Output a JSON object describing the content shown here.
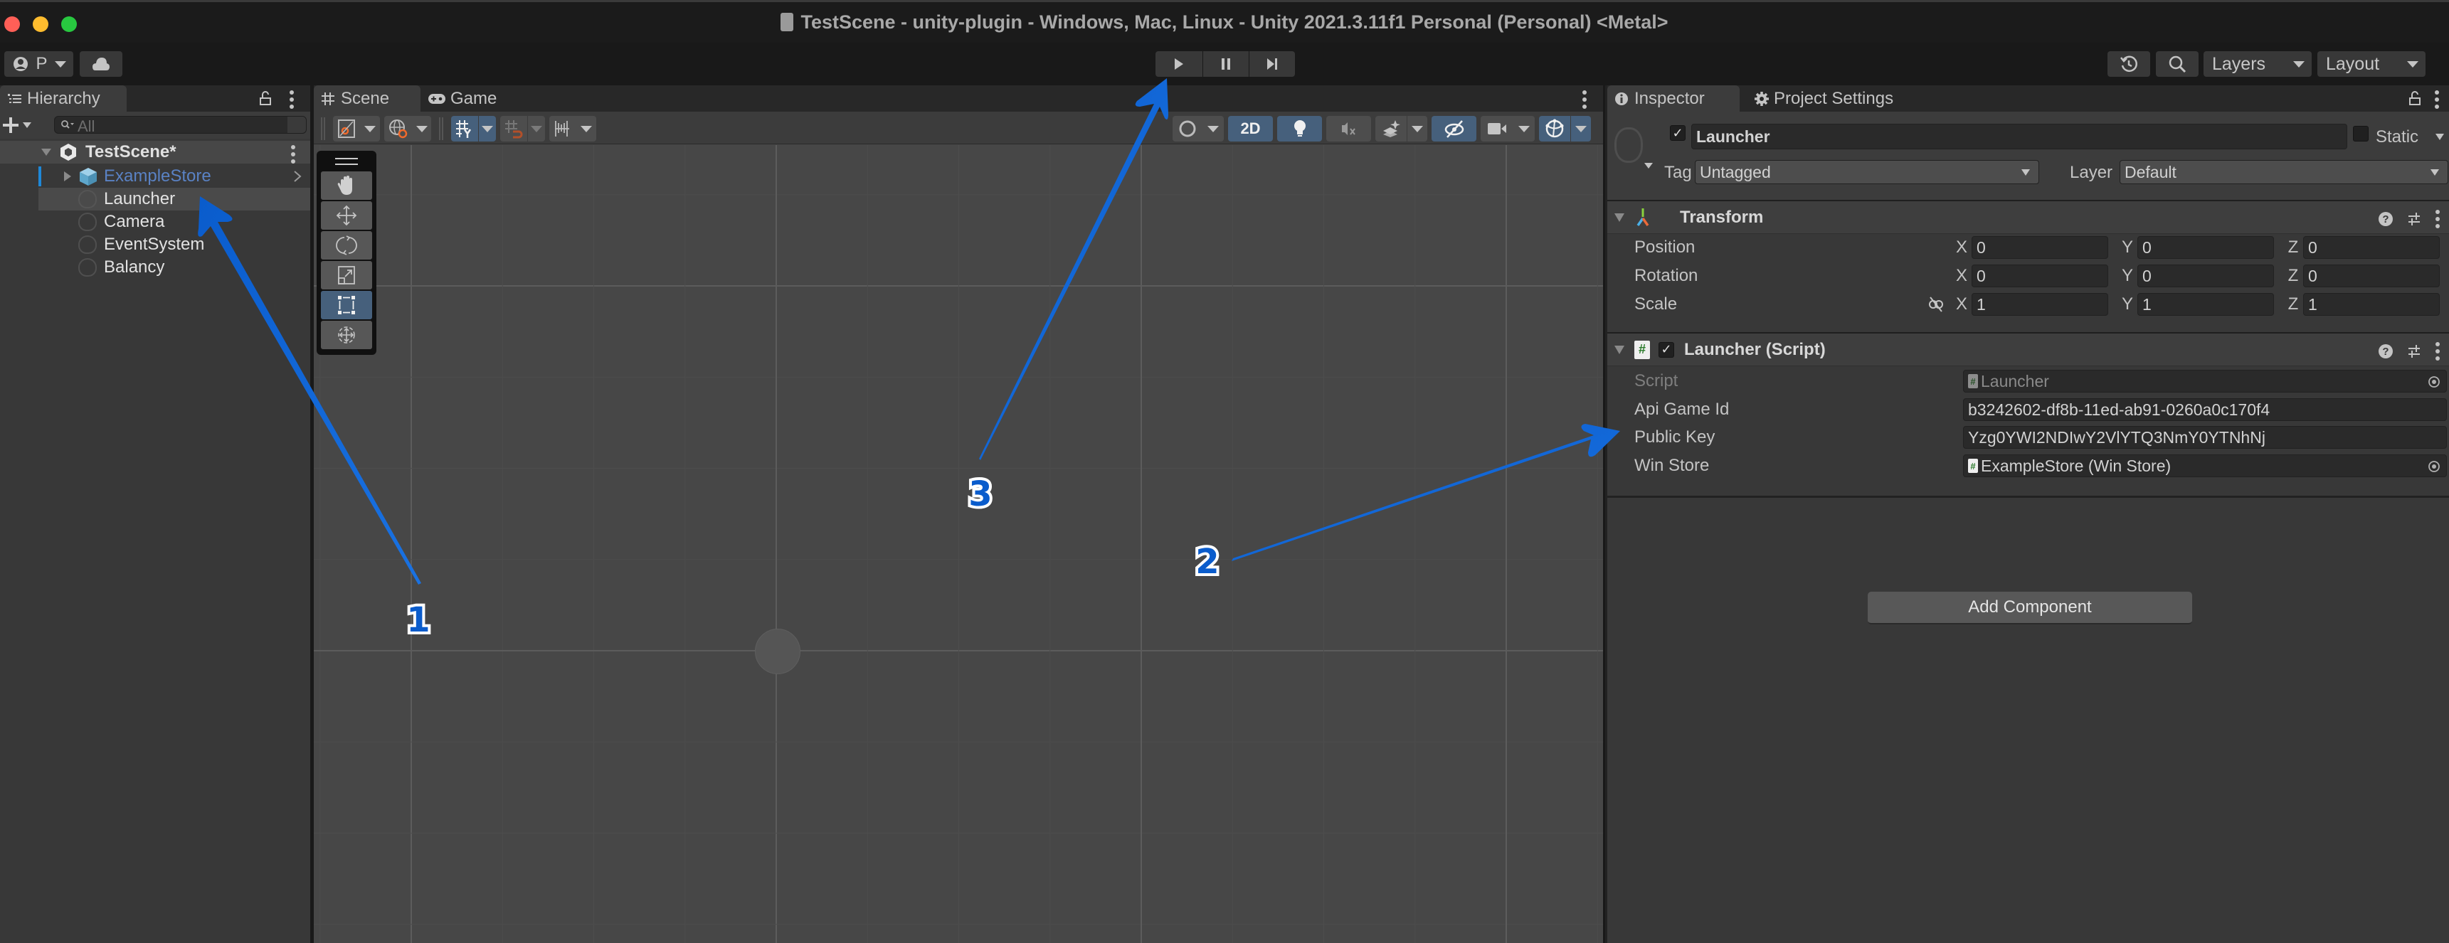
{
  "window": {
    "title": "TestScene - unity-plugin - Windows, Mac, Linux - Unity 2021.3.11f1 Personal (Personal) <Metal>",
    "traffic_lights": [
      "#ff5f57",
      "#febc2e",
      "#28c840"
    ]
  },
  "toolbar": {
    "account_label": "P",
    "account_icon": "user-icon",
    "cloud_icon": "cloud-icon",
    "play_icon": "play-icon",
    "pause_icon": "pause-icon",
    "step_icon": "step-icon",
    "history_icon": "history-icon",
    "search_icon": "search-icon",
    "layers_label": "Layers",
    "layout_label": "Layout"
  },
  "hierarchy": {
    "tab_label": "Hierarchy",
    "search_placeholder": "All",
    "scene_name": "TestScene*",
    "items": [
      {
        "label": "ExampleStore",
        "type": "prefab",
        "expandable": true
      },
      {
        "label": "Launcher",
        "type": "gameobject",
        "selected": true
      },
      {
        "label": "Camera",
        "type": "gameobject"
      },
      {
        "label": "EventSystem",
        "type": "gameobject"
      },
      {
        "label": "Balancy",
        "type": "gameobject"
      }
    ]
  },
  "scene": {
    "tabs": [
      {
        "label": "Scene",
        "icon": "grid-hash-icon",
        "active": true
      },
      {
        "label": "Game",
        "icon": "gamepad-icon",
        "active": false
      }
    ],
    "mode_2d_label": "2D",
    "tools": [
      "hand-tool",
      "move-tool",
      "rotate-tool",
      "scale-tool",
      "rect-tool",
      "transform-tool"
    ],
    "active_tool": "rect-tool"
  },
  "inspector": {
    "tabs": [
      {
        "label": "Inspector",
        "icon": "info-icon",
        "active": true
      },
      {
        "label": "Project Settings",
        "icon": "gear-icon",
        "active": false
      }
    ],
    "object_name": "Launcher",
    "object_active": true,
    "static_label": "Static",
    "static_checked": false,
    "tag_label": "Tag",
    "tag_value": "Untagged",
    "layer_label": "Layer",
    "layer_value": "Default",
    "transform": {
      "title": "Transform",
      "rows": [
        {
          "label": "Position",
          "x": "0",
          "y": "0",
          "z": "0"
        },
        {
          "label": "Rotation",
          "x": "0",
          "y": "0",
          "z": "0"
        },
        {
          "label": "Scale",
          "x": "1",
          "y": "1",
          "z": "1"
        }
      ],
      "axis_labels": [
        "X",
        "Y",
        "Z"
      ]
    },
    "script_component": {
      "title": "Launcher (Script)",
      "enabled": true,
      "fields": [
        {
          "label": "Script",
          "value": "Launcher",
          "kind": "object-ref",
          "disabled": true
        },
        {
          "label": "Api Game Id",
          "value": "b3242602-df8b-11ed-ab91-0260a0c170f4",
          "kind": "text"
        },
        {
          "label": "Public Key",
          "value": "Yzg0YWI2NDIwY2VlYTQ3NmY0YTNhNj",
          "kind": "text"
        },
        {
          "label": "Win Store",
          "value": "ExampleStore (Win Store)",
          "kind": "object-ref"
        }
      ]
    },
    "add_component_label": "Add Component"
  },
  "annotations": {
    "color": "#0a62d2",
    "labels": [
      {
        "number": "1",
        "target": "hierarchy Launcher item"
      },
      {
        "number": "2",
        "target": "Launcher script fields"
      },
      {
        "number": "3",
        "target": "play button"
      }
    ]
  }
}
